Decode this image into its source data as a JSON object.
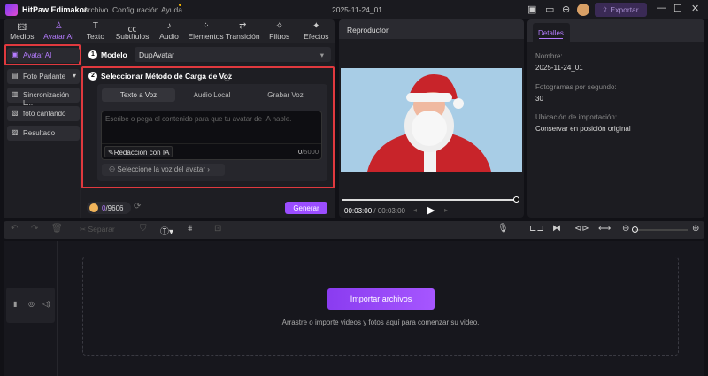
{
  "app": {
    "title": "HitPaw Edimakor",
    "menu": [
      "Archivo",
      "Configuración",
      "Ayuda"
    ],
    "project": "2025-11-24_01",
    "export_label": "Exportar"
  },
  "tabs": [
    {
      "label": "Medios",
      "icon": "image-icon"
    },
    {
      "label": "Avatar AI",
      "icon": "avatar-icon",
      "active": true
    },
    {
      "label": "Texto",
      "icon": "text-icon"
    },
    {
      "label": "Subtítulos",
      "icon": "cc-icon"
    },
    {
      "label": "Audio",
      "icon": "music-icon"
    },
    {
      "label": "Elementos",
      "icon": "elements-icon"
    },
    {
      "label": "Transición",
      "icon": "transition-icon"
    },
    {
      "label": "Filtros",
      "icon": "filter-icon"
    },
    {
      "label": "Efectos",
      "icon": "effects-icon"
    }
  ],
  "sidebar": {
    "items": [
      {
        "label": "Avatar AI"
      },
      {
        "label": "Foto Parlante"
      },
      {
        "label": "Sincronización L..."
      },
      {
        "label": "foto cantando"
      },
      {
        "label": "Resultado"
      }
    ]
  },
  "model": {
    "step": "1",
    "label": "Modelo",
    "value": "DupAvatar"
  },
  "voice": {
    "step": "2",
    "label": "Seleccionar Método de Carga de Voz",
    "tabs": [
      "Texto a Voz",
      "Audio Local",
      "Grabar Voz"
    ],
    "placeholder": "Escribe o pega el contenido para que tu avatar de IA hable.",
    "ai_button": "Redacción con IA",
    "counter_used": "0",
    "counter_max": "/5000",
    "select_voice": "Seleccione la voz del avatar"
  },
  "footer": {
    "credits_used": "0",
    "credits_total": "/9606",
    "generate": "Generar"
  },
  "player": {
    "title": "Reproductor",
    "time_current": "00:03:00",
    "time_total": "/ 00:03:00",
    "progress": 1.0
  },
  "details": {
    "tab": "Detalles",
    "fields": [
      {
        "label": "Nombre:",
        "value": "2025-11-24_01"
      },
      {
        "label": "Fotogramas por segundo:",
        "value": "30"
      },
      {
        "label": "Ubicación de importación:",
        "value": "Conservar en posición original"
      }
    ]
  },
  "timeline": {
    "split": "Separar",
    "import_button": "Importar archivos",
    "hint": "Arrastre o importe videos y fotos aquí para comenzar su video."
  },
  "colors": {
    "accent": "#9b4dff",
    "highlight": "#e0393e",
    "video_bg": "#a8cde6"
  }
}
